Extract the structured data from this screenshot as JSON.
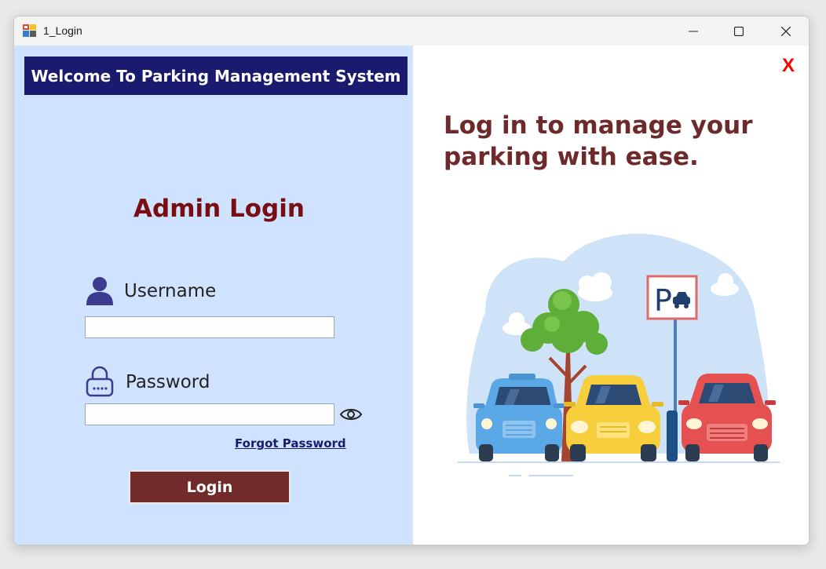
{
  "window": {
    "title": "1_Login",
    "minimize_glyph": "—",
    "maximize_glyph": "☐",
    "close_glyph": "✕"
  },
  "left": {
    "banner": "Welcome To Parking Management System",
    "heading": "Admin Login",
    "username": {
      "label": "Username",
      "value": "",
      "icon": "user-icon"
    },
    "password": {
      "label": "Password",
      "value": "",
      "icon": "lock-icon",
      "toggle_icon": "eye-icon"
    },
    "forgot_link": "Forgot Password",
    "login_button": "Login"
  },
  "right": {
    "close_label": "X",
    "tagline_line1": "Log in to manage your",
    "tagline_line2": "parking with ease.",
    "sign_letter": "P",
    "illustration": "parking-illustration"
  },
  "colors": {
    "left_bg": "#cfe2fe",
    "banner_bg": "#1a1b6e",
    "heading": "#7a0d12",
    "button_bg": "#702b2a",
    "tagline": "#6e2a2a",
    "close": "#ff0000"
  }
}
